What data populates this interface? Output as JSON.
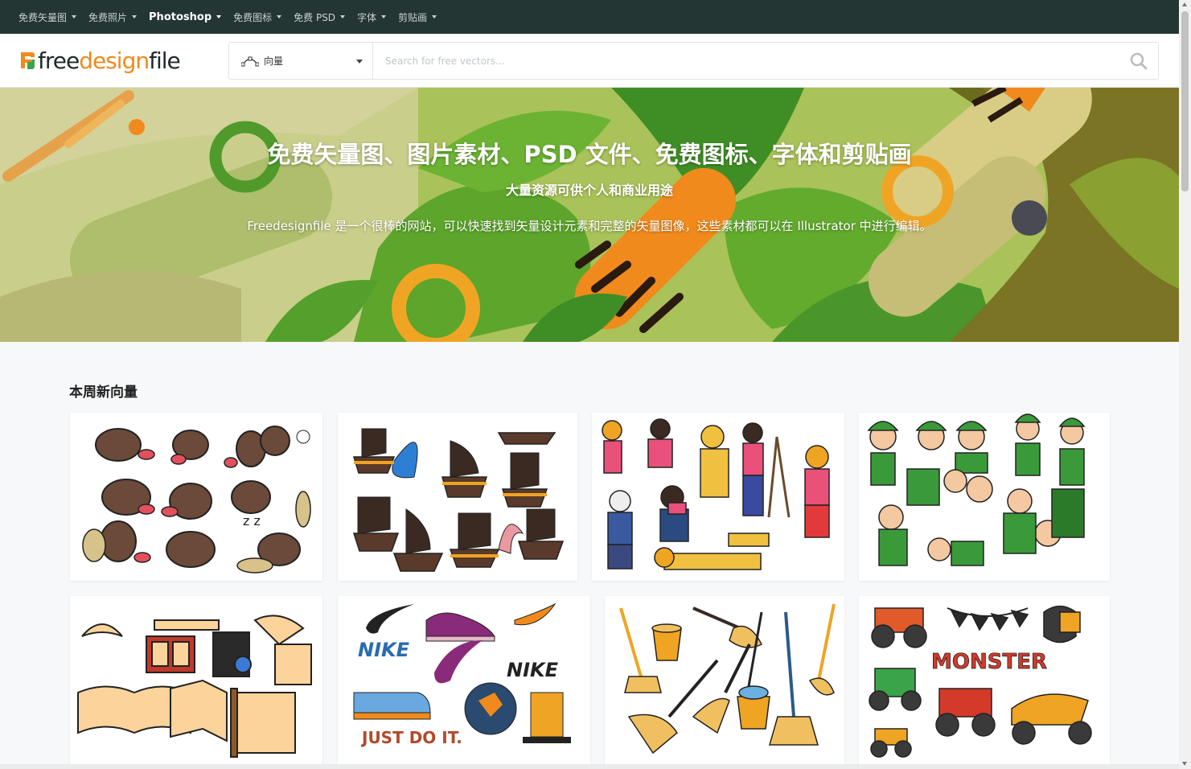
{
  "topnav": {
    "items": [
      {
        "label": "免费矢量图"
      },
      {
        "label": "免费照片"
      },
      {
        "label": "Photoshop"
      },
      {
        "label": "免费图标"
      },
      {
        "label": "免费 PSD"
      },
      {
        "label": "字体"
      },
      {
        "label": "剪贴画"
      }
    ]
  },
  "header": {
    "logo": {
      "part1": "free",
      "part2": "design",
      "part3": "file"
    },
    "search": {
      "category": "向量",
      "placeholder": "Search for free vectors...",
      "icon": "search-icon"
    }
  },
  "hero": {
    "title": "免费矢量图、图片素材、PSD 文件、免费图标、字体和剪贴画",
    "subtitle": "大量资源可供个人和商业用途",
    "description": "Freedesignfile 是一个很棒的网站，可以快速找到矢量设计元素和完整的矢量图像，这些素材都可以在 Illustrator 中进行编辑。"
  },
  "section": {
    "title": "本周新向量"
  },
  "cards": [
    {
      "subject": "platypus"
    },
    {
      "subject": "pirate-ships"
    },
    {
      "subject": "photographers"
    },
    {
      "subject": "peter-pan"
    },
    {
      "subject": "books"
    },
    {
      "subject": "nike-sneakers"
    },
    {
      "subject": "brooms-mops"
    },
    {
      "subject": "monster-trucks"
    }
  ],
  "card_texts": {
    "nike1": "NIKE",
    "nike2": "NIKE",
    "justdoit": "JUST DO IT.",
    "monster": "MONSTER"
  },
  "colors": {
    "topnav_bg": "#243634",
    "accent_orange": "#f08a1c",
    "hero_green": "#8fb04a"
  }
}
